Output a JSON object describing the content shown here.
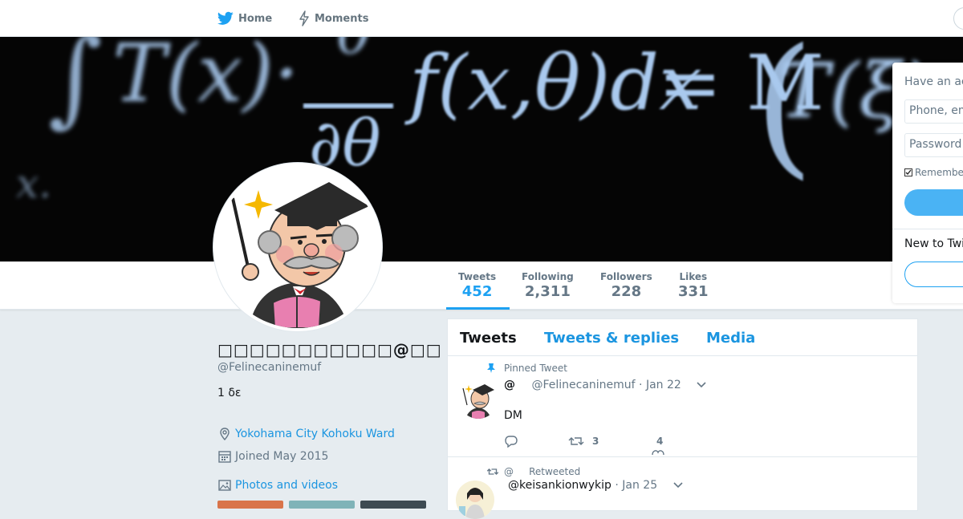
{
  "topbar": {
    "home_label": "Home",
    "moments_label": "Moments"
  },
  "profile": {
    "name": "□□□□□□□□□□□@□□",
    "handle": "@Felinecaninemuf",
    "bio": "1  δε",
    "location": "Yokohama City Kohoku Ward",
    "joined": "Joined May 2015",
    "photos_label": "Photos and videos"
  },
  "stats": [
    {
      "label": "Tweets",
      "value": "452"
    },
    {
      "label": "Following",
      "value": "2,311"
    },
    {
      "label": "Followers",
      "value": "228"
    },
    {
      "label": "Likes",
      "value": "331"
    }
  ],
  "timeline": {
    "tabs": [
      "Tweets",
      "Tweets & replies",
      "Media"
    ],
    "pinned_tweet": {
      "context": "Pinned Tweet",
      "fullname": "@",
      "handle": "@Felinecaninemuf",
      "date": "· Jan 22",
      "text": "DM",
      "retweets": "3",
      "likes": "4"
    },
    "retweeted_tweet": {
      "context": "@     Retweeted",
      "handle": "@keisankionwykip",
      "date": "· Jan 25"
    }
  },
  "login": {
    "title": "Have an account?",
    "phone_placeholder": "Phone, email or username",
    "password_placeholder": "Password",
    "remember": "Remember me",
    "new_to": "New to Twitter?"
  },
  "colors": {
    "accent": "#1da1f2",
    "link": "#1b95e0",
    "background": "#e6ecf0"
  },
  "icons": [
    "twitter-bird-icon",
    "lightning-icon",
    "map-pin-icon",
    "calendar-icon",
    "image-icon",
    "pin-icon",
    "retweet-icon",
    "reply-icon",
    "heart-icon",
    "chevron-down-icon"
  ]
}
